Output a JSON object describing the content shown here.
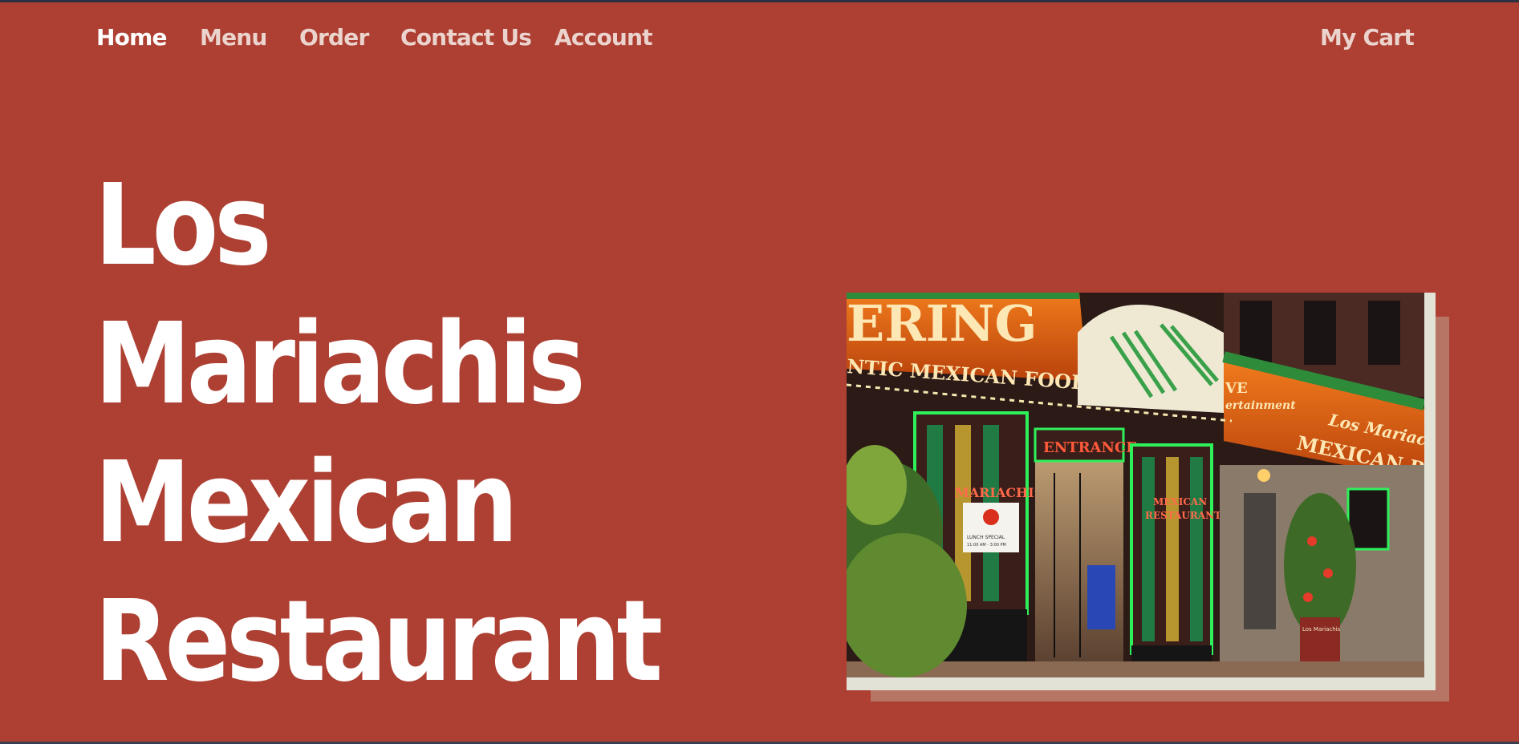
{
  "nav": {
    "home": "Home",
    "menu": "Menu",
    "order": "Order",
    "contact": "Contact Us",
    "account": "Account",
    "cart": "My Cart"
  },
  "hero": {
    "title_lines": [
      "Los",
      "Mariachis",
      "Mexican",
      "Restaurant"
    ]
  },
  "storefront": {
    "catering_sign": "ERING",
    "catering_sub": "NTIC MEXICAN FOOD",
    "entrance": "ENTRANCE",
    "window_left": "MARIACHIS",
    "window_right_1": "MEXICAN",
    "window_right_2": "RESTAURANT",
    "live_1": "VE",
    "live_2": "ertainment",
    "sign_los": "Los Mariachis",
    "sign_mexican": "MEXICAN RESTAURA",
    "lunch_1": "LUNCH SPECIAL",
    "lunch_2": "11:00 AM - 3:00 PM",
    "planter": "Los Mariachis"
  },
  "colors": {
    "background": "#ad4033",
    "nav_text": "#ecd4ce",
    "nav_active": "#ffffff",
    "hero_text": "#ffffff",
    "photo_frame": "#e3e2d7",
    "photo_shadow": "#b77565"
  }
}
